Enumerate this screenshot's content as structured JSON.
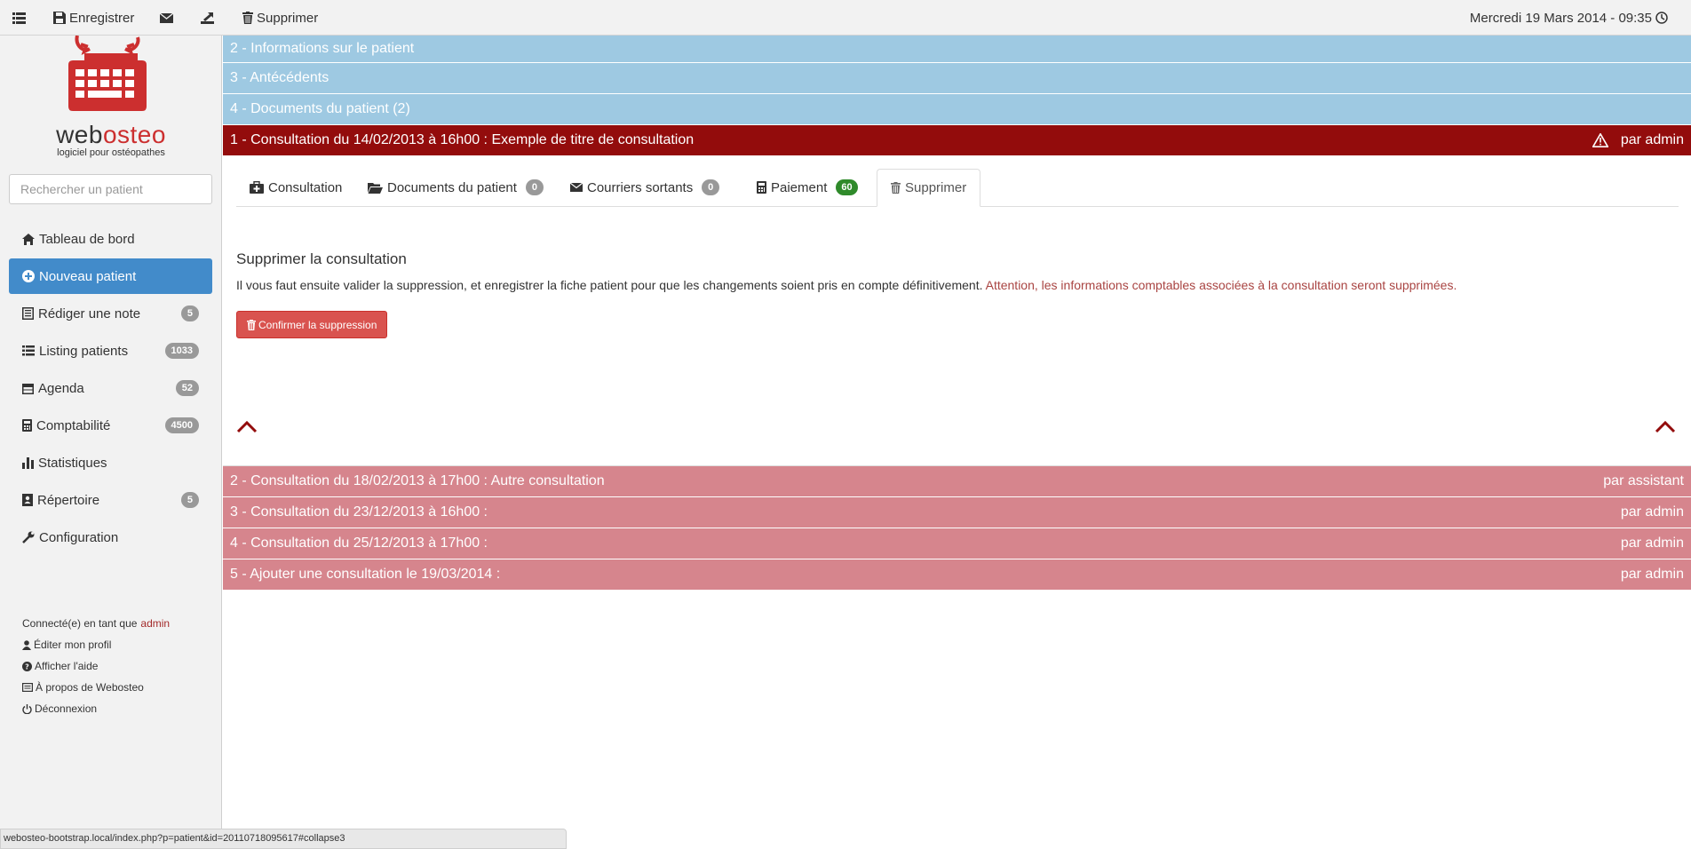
{
  "toolbar": {
    "menu_icon": "list-icon",
    "save_label": "Enregistrer",
    "mail_icon": "envelope-icon",
    "export_icon": "export-icon",
    "delete_label": "Supprimer",
    "datetime": "Mercredi 19 Mars 2014 - 09:35"
  },
  "brand": {
    "name_prefix": "web",
    "name_suffix": "osteo",
    "tagline": "logiciel pour ostéopathes",
    "accent_color": "#cc2f2f"
  },
  "search": {
    "placeholder": "Rechercher un patient"
  },
  "nav": [
    {
      "label": "Tableau de bord",
      "icon": "home-icon"
    },
    {
      "label": "Nouveau patient",
      "icon": "plus-circle-icon",
      "active": true
    },
    {
      "label": "Rédiger une note",
      "icon": "note-icon",
      "badge": "5"
    },
    {
      "label": "Listing patients",
      "icon": "list-icon",
      "badge": "1033"
    },
    {
      "label": "Agenda",
      "icon": "calendar-icon",
      "badge": "52"
    },
    {
      "label": "Comptabilité",
      "icon": "calculator-icon",
      "badge": "4500"
    },
    {
      "label": "Statistiques",
      "icon": "bar-chart-icon"
    },
    {
      "label": "Répertoire",
      "icon": "address-book-icon",
      "badge": "5"
    },
    {
      "label": "Configuration",
      "icon": "wrench-icon"
    }
  ],
  "user": {
    "connected_prefix": "Connecté(e) en tant que",
    "username": "admin",
    "edit_profile": "Éditer mon profil",
    "help": "Afficher l'aide",
    "about": "À propos de Webosteo",
    "logout": "Déconnexion"
  },
  "status_url": "webosteo-bootstrap.local/index.php?p=patient&id=20110718095617#collapse3",
  "sections": [
    {
      "title": "2 - Informations sur le patient"
    },
    {
      "title": "3 - Antécédents"
    },
    {
      "title": "4 - Documents du patient (2)"
    }
  ],
  "current_consultation": {
    "title": "1 - Consultation du 14/02/2013 à 16h00 : Exemple de titre de consultation",
    "author": "par admin",
    "warning_icon": "warning-icon",
    "color": "#930c0c"
  },
  "tabs": [
    {
      "label": "Consultation",
      "icon": "medkit-icon"
    },
    {
      "label": "Documents du patient",
      "icon": "folder-icon",
      "badge": "0"
    },
    {
      "label": "Courriers sortants",
      "icon": "envelope-icon",
      "badge": "0"
    },
    {
      "label": "Paiement",
      "icon": "calculator-icon",
      "badge": "60",
      "badge_color": "#2f8a2a"
    },
    {
      "label": "Supprimer",
      "icon": "trash-icon",
      "active": true
    }
  ],
  "delete_pane": {
    "title": "Supprimer la consultation",
    "text": "Il vous faut ensuite valider la suppression, et enregistrer la fiche patient pour que les changements soient pris en compte définitivement.",
    "warning": "Attention, les informations comptables associées à la consultation seront supprimées.",
    "confirm_label": "Confirmer la suppression",
    "button_color": "#d9534f"
  },
  "other_consultations": [
    {
      "title": "2 - Consultation du 18/02/2013 à 17h00 : Autre consultation",
      "author": "par assistant"
    },
    {
      "title": "3 - Consultation du 23/12/2013 à 16h00 :",
      "author": "par admin"
    },
    {
      "title": "4 - Consultation du 25/12/2013 à 17h00 :",
      "author": "par admin"
    },
    {
      "title": "5 - Ajouter une consultation le 19/03/2014 :",
      "author": "par admin"
    }
  ],
  "colors": {
    "section_blue": "#9ec9e2",
    "consultation_pink": "#d6858d",
    "active_nav": "#428bca"
  }
}
